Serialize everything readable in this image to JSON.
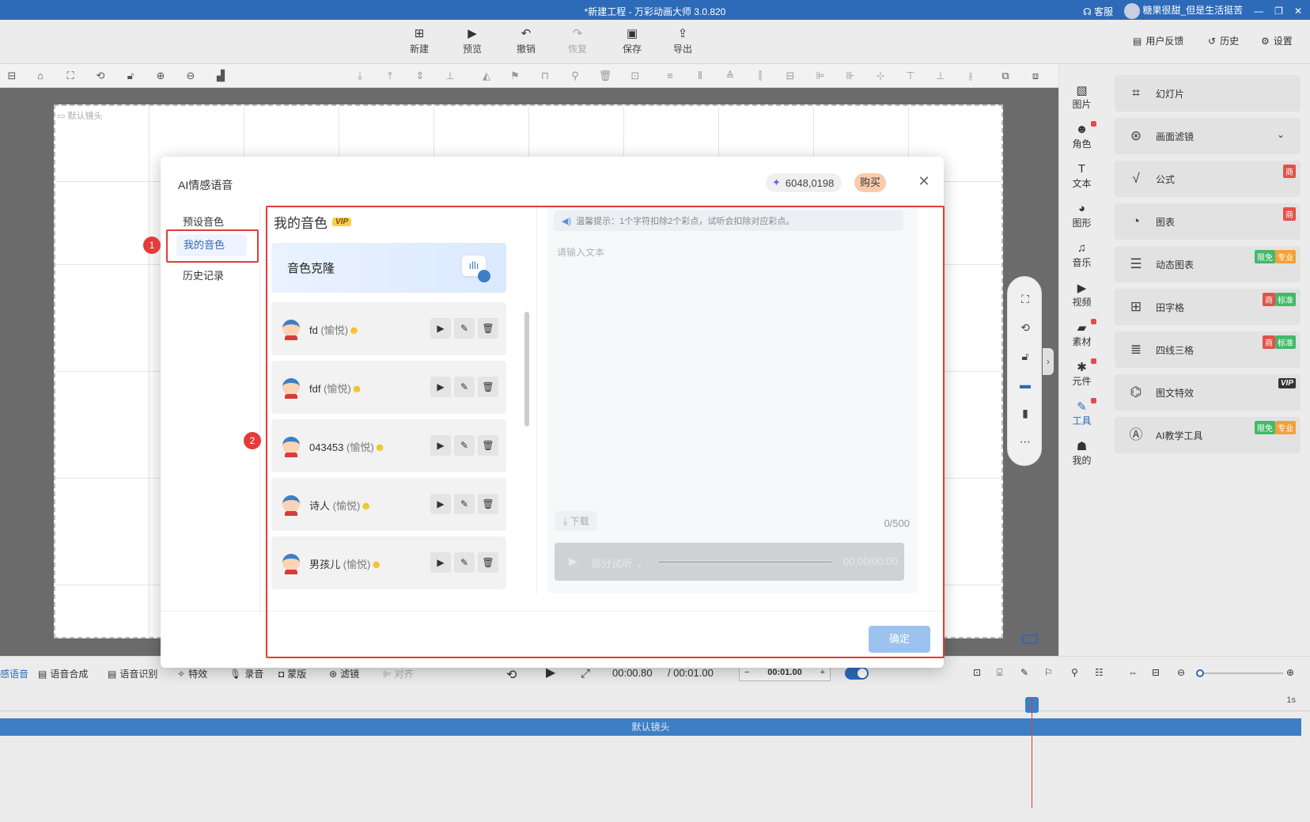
{
  "window": {
    "title": "*新建工程 - 万彩动画大师 3.0.820",
    "service": "客服",
    "user": "糖果很甜_但是生活挺苦"
  },
  "menubar": {
    "items": [
      {
        "label": "新建",
        "icon": "new-icon"
      },
      {
        "label": "预览",
        "icon": "preview-icon"
      },
      {
        "label": "撤销",
        "icon": "undo-icon"
      },
      {
        "label": "恢复",
        "icon": "redo-icon"
      },
      {
        "label": "保存",
        "icon": "save-icon"
      },
      {
        "label": "导出",
        "icon": "export-icon"
      }
    ],
    "right": [
      {
        "label": "用户反馈"
      },
      {
        "label": "历史"
      },
      {
        "label": "设置"
      }
    ]
  },
  "canvas": {
    "camera_label": "默认镜头"
  },
  "right_tabs": [
    {
      "label": "图片",
      "icon": "image-icon"
    },
    {
      "label": "角色",
      "icon": "character-icon"
    },
    {
      "label": "文本",
      "icon": "text-icon"
    },
    {
      "label": "图形",
      "icon": "shape-icon"
    },
    {
      "label": "音乐",
      "icon": "music-icon"
    },
    {
      "label": "视频",
      "icon": "video-icon"
    },
    {
      "label": "素材",
      "icon": "material-icon"
    },
    {
      "label": "元件",
      "icon": "component-icon"
    },
    {
      "label": "工具",
      "icon": "tool-icon"
    },
    {
      "label": "我的",
      "icon": "user-icon"
    }
  ],
  "right_panel": [
    {
      "label": "幻灯片",
      "badges": []
    },
    {
      "label": "画面滤镜",
      "badges": []
    },
    {
      "label": "公式",
      "badges": [
        "商"
      ]
    },
    {
      "label": "图表",
      "badges": [
        "商"
      ]
    },
    {
      "label": "动态图表",
      "badges": [
        "限免",
        "专业"
      ]
    },
    {
      "label": "田字格",
      "badges": [
        "商",
        "标准"
      ]
    },
    {
      "label": "四线三格",
      "badges": [
        "商",
        "标准"
      ]
    },
    {
      "label": "图文特效",
      "badges": [
        "VIP"
      ]
    },
    {
      "label": "AI教学工具",
      "badges": [
        "限免",
        "专业"
      ]
    }
  ],
  "bottom_toolbar": {
    "items": [
      "语音合成",
      "语音识别",
      "特效",
      "录音",
      "蒙版",
      "滤镜",
      "对齐"
    ],
    "left_cut": "感语音",
    "time_current": "00:00.80",
    "time_total": "/ 00:01.00",
    "duration": "00:01.00"
  },
  "timeline": {
    "track_label": "默认镜头",
    "scale_end": "1s"
  },
  "modal": {
    "title": "AI情感语音",
    "points": "6048,0198",
    "buy": "购买",
    "nav": [
      "预设音色",
      "我的音色",
      "历史记录"
    ],
    "section_title": "我的音色",
    "vip": "VIP",
    "clone_label": "音色克隆",
    "voices": [
      {
        "name": "fd",
        "emotion": "(愉悦)"
      },
      {
        "name": "fdf",
        "emotion": "(愉悦)"
      },
      {
        "name": "043453",
        "emotion": "(愉悦)"
      },
      {
        "name": "诗人",
        "emotion": "(愉悦)"
      },
      {
        "name": "男孩儿",
        "emotion": "(愉悦)"
      }
    ],
    "tip": "温馨提示：1个字符扣除2个彩点，试听会扣除对应彩点。",
    "placeholder": "请输入文本",
    "download": "下载",
    "count": "0/500",
    "preview_label": "部分试听",
    "player_time": "00:00/00:00",
    "ok": "确定"
  },
  "annotations": {
    "n1": "1",
    "n2": "2"
  },
  "colors": {
    "accent": "#2d6ab8",
    "annotation_red": "#e43b3b",
    "track": "#3d7fc5"
  }
}
